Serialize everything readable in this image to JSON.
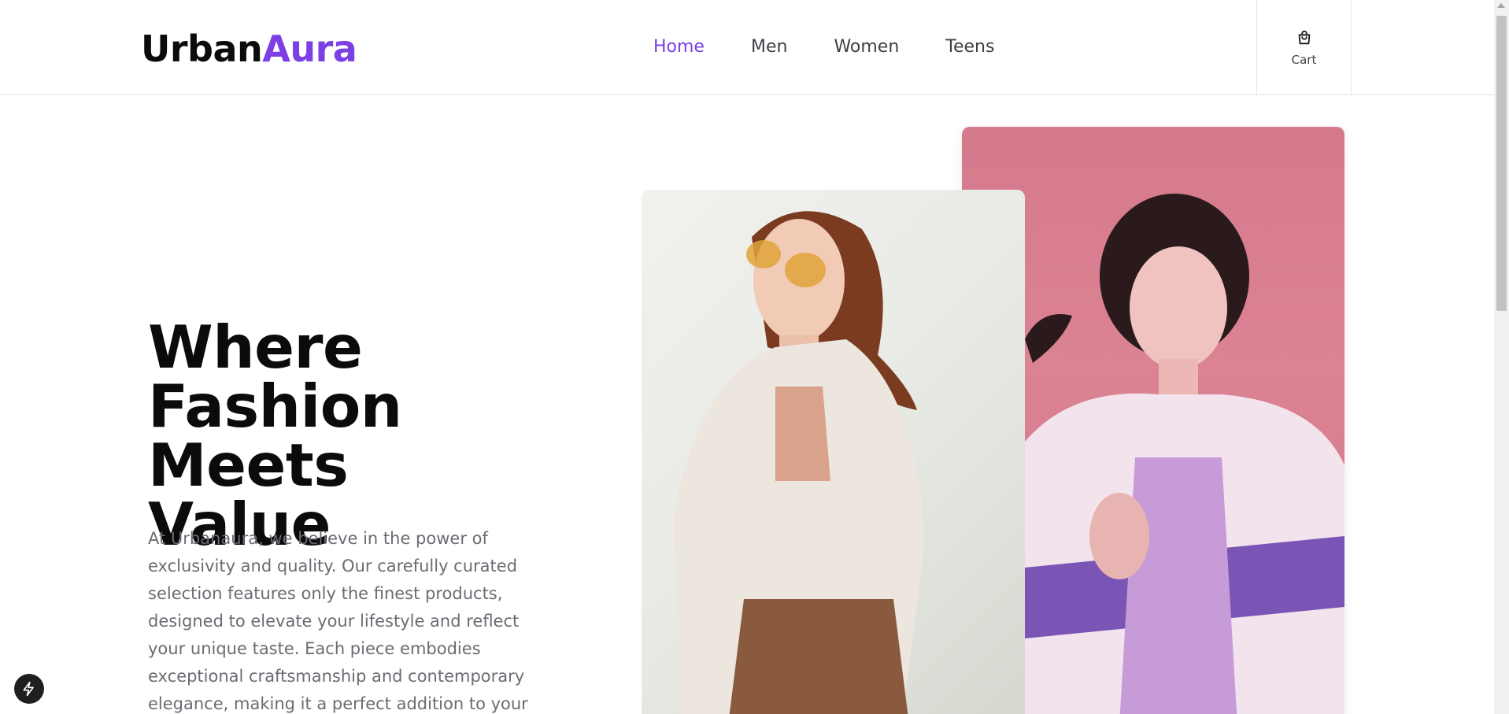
{
  "brand": {
    "part1": "Urban",
    "part2": "Aura",
    "accent_color": "#7b3fe4"
  },
  "nav": {
    "items": [
      {
        "label": "Home",
        "active": true
      },
      {
        "label": "Men",
        "active": false
      },
      {
        "label": "Women",
        "active": false
      },
      {
        "label": "Teens",
        "active": false
      }
    ]
  },
  "cart": {
    "label": "Cart",
    "icon": "shopping-bag-icon"
  },
  "hero": {
    "title_line1": "Where",
    "title_line2": "Fashion Meets",
    "title_line3": "Value",
    "description": "At Urbanaura, we believe in the power of exclusivity and quality. Our carefully curated selection features only the finest products, designed to elevate your lifestyle and reflect your unique taste. Each piece embodies exceptional craftsmanship and contemporary elegance, making it a perfect addition to your collection."
  },
  "images": [
    {
      "name": "model-light-background-photo"
    },
    {
      "name": "model-pink-background-photo"
    }
  ],
  "fab": {
    "icon": "lightning-bolt-icon"
  }
}
